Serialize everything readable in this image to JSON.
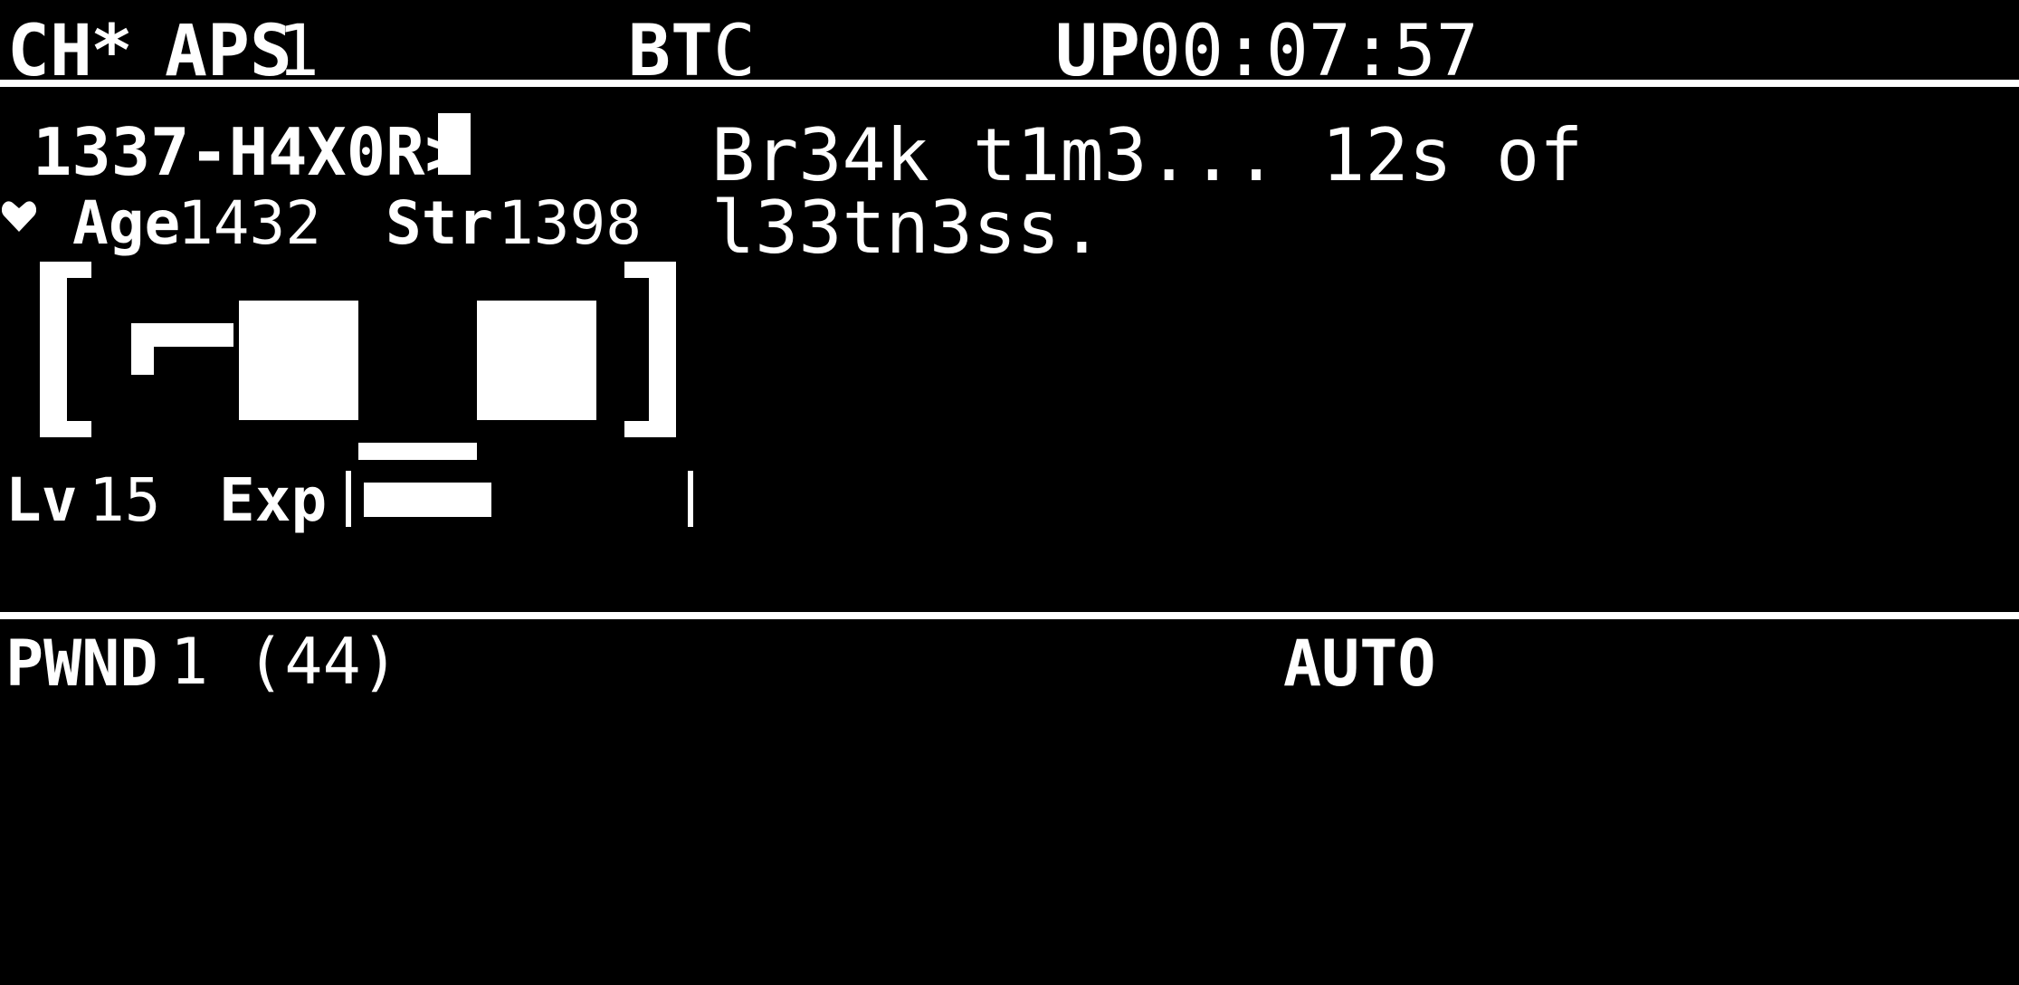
{
  "top_bar": {
    "channel_label": "CH",
    "channel_value": "*",
    "aps_label": "APS",
    "aps_value": "1",
    "bt_label": "BT",
    "bt_value": "C",
    "uptime_label": "UP",
    "uptime_value": "00:07:57"
  },
  "pet": {
    "name_prompt": "1337-H4X0R>",
    "age_label": "Age",
    "age_value": "1432",
    "str_label": "Str",
    "str_value": "1398",
    "level_label": "Lv",
    "level_value": "15",
    "exp_label": "Exp",
    "exp_progress": 0.4
  },
  "message": {
    "line1": "Br34k t1m3... 12s of",
    "line2": "l33tn3ss."
  },
  "bottom_bar": {
    "pwnd_label": "PWND",
    "pwnd_value": "1 (44)",
    "mode": "AUTO"
  },
  "icons": {
    "heart": "heart-icon",
    "cursor": "cursor-block-icon"
  },
  "colors": {
    "background": "#000000",
    "foreground": "#ffffff"
  }
}
